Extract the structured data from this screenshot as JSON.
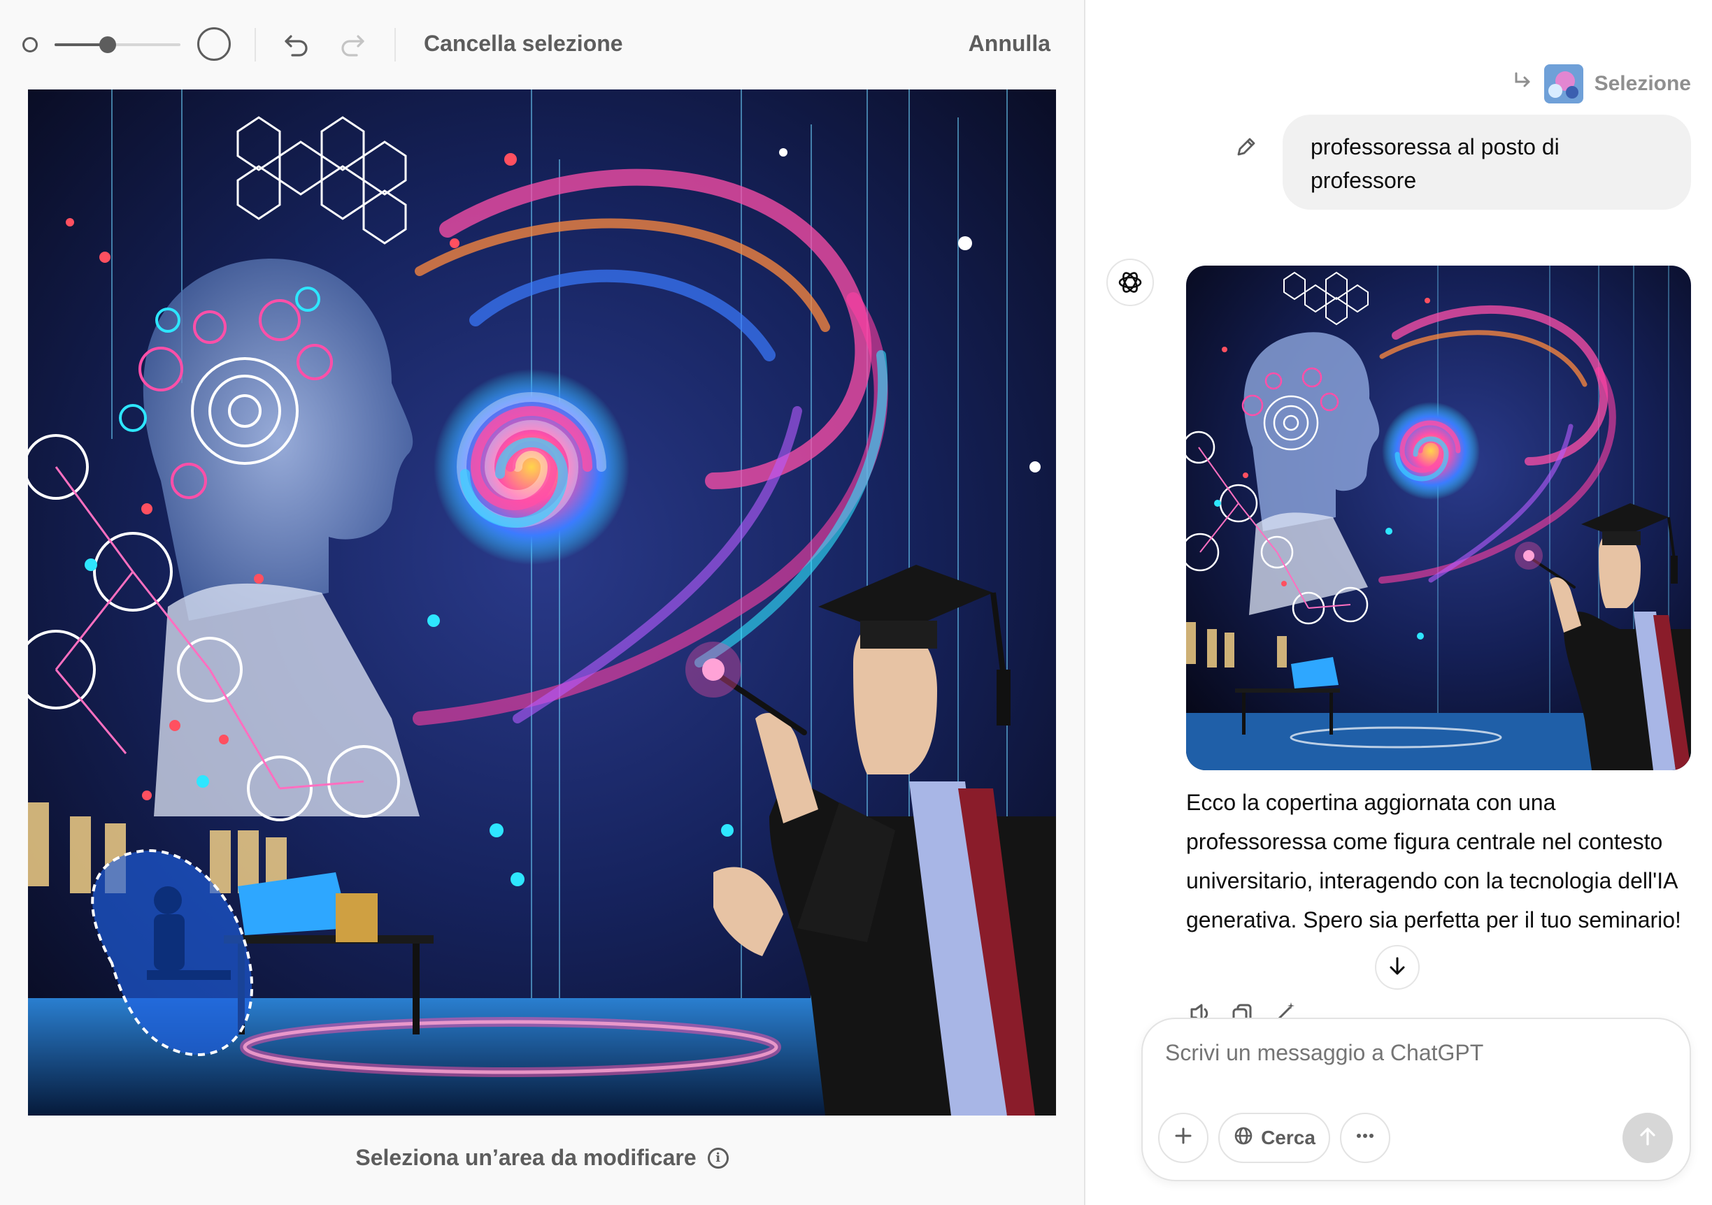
{
  "editor": {
    "toolbar": {
      "brush_size_value": 0.42,
      "clear_selection_label": "Cancella selezione",
      "cancel_label": "Annulla"
    },
    "hint_label": "Seleziona un’area da modificare",
    "hint_info_glyph": "i"
  },
  "chat": {
    "selection_label": "Selezione",
    "user_message": "professoressa al posto di professore",
    "assistant_message": "Ecco la copertina aggiornata con una professoressa come figura centrale nel contesto universitario, interagendo con la tecnologia dell'IA generativa. Spero sia perfetta per il tuo seminario!",
    "composer": {
      "placeholder": "Scrivi un messaggio a ChatGPT",
      "search_label": "Cerca"
    }
  },
  "colors": {
    "accent_pink": "#ff3fa4",
    "accent_cyan": "#2ee6ff",
    "bg_dark": "#0a0b24",
    "selection_blue": "#1f5fe0"
  },
  "icons": [
    "brush-small-icon",
    "brush-large-icon",
    "undo-icon",
    "redo-icon",
    "info-icon",
    "reply-arrow-icon",
    "pencil-icon",
    "openai-logo-icon",
    "speaker-icon",
    "copy-icon",
    "magic-wand-icon",
    "arrow-down-icon",
    "plus-icon",
    "globe-icon",
    "more-icon",
    "arrow-up-icon"
  ]
}
